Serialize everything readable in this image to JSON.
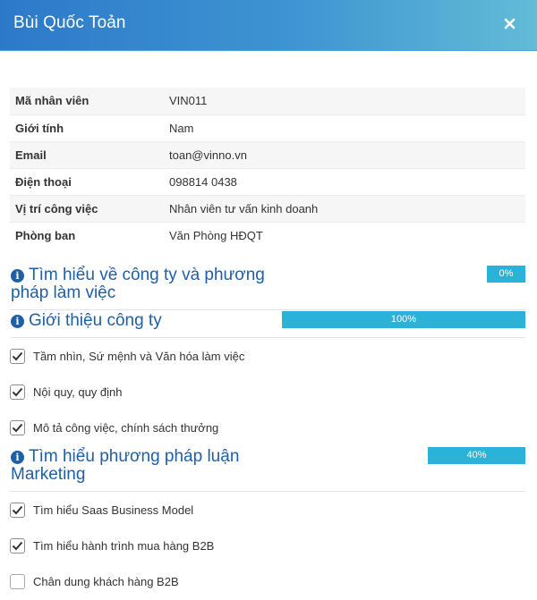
{
  "modal": {
    "title": "Bùi Quốc Toản",
    "close_icon": "close-icon"
  },
  "profile": {
    "rows": [
      {
        "label": "Mã nhân viên",
        "value": "VIN011"
      },
      {
        "label": "Giới tính",
        "value": "Nam"
      },
      {
        "label": "Email",
        "value": "toan@vinno.vn"
      },
      {
        "label": "Điện thoại",
        "value": "098814 0438"
      },
      {
        "label": "Vị trí công việc",
        "value": "Nhân viên tư vấn kinh doanh"
      },
      {
        "label": "Phòng ban",
        "value": "Văn Phòng HĐQT"
      }
    ]
  },
  "sections": [
    {
      "title_line1": "Tìm hiểu về công ty và phương",
      "title_line2": "pháp làm việc",
      "progress_label": "0%",
      "progress": 0
    },
    {
      "title_line1": "Giới thiệu công ty",
      "progress_label": "100%",
      "progress": 100,
      "items": [
        {
          "label": "Tầm nhìn, Sứ mệnh và Văn hóa làm việc",
          "checked": true
        },
        {
          "label": "Nội quy, quy định",
          "checked": true
        },
        {
          "label": "Mô tả công việc, chính sách thưởng",
          "checked": true
        }
      ]
    },
    {
      "title_line1": "Tìm hiểu phương pháp luận",
      "title_line2": "Marketing",
      "progress_label": "40%",
      "progress": 40,
      "items": [
        {
          "label": "Tìm hiểu Saas Business Model",
          "checked": true
        },
        {
          "label": "Tìm hiểu hành trình mua hàng B2B",
          "checked": true
        },
        {
          "label": "Chân dung khách hàng B2B",
          "checked": false
        }
      ]
    }
  ],
  "colors": {
    "header_start": "#2c79c9",
    "header_end": "#62bcd6",
    "section_title": "#1f5fa6",
    "progress_fill": "#2bb2d9"
  },
  "icons": {
    "info": "info-icon",
    "check": "check-icon"
  }
}
